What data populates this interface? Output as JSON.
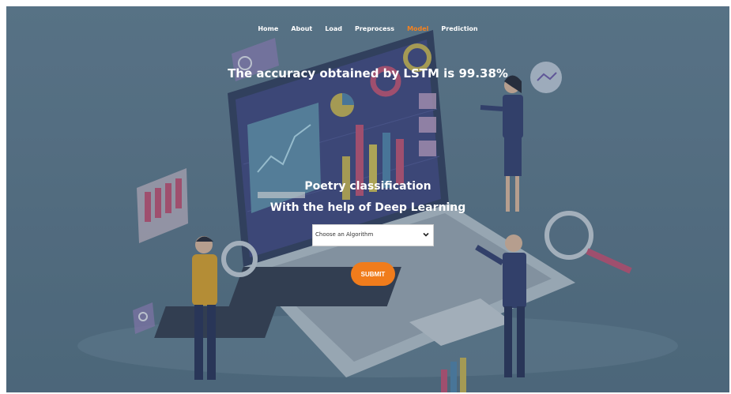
{
  "nav": {
    "items": [
      {
        "label": "Home"
      },
      {
        "label": "About"
      },
      {
        "label": "Load"
      },
      {
        "label": "Preprocess"
      },
      {
        "label": "Model"
      },
      {
        "label": "Prediction"
      }
    ],
    "active": "Model"
  },
  "accuracy_text": "The accuracy obtained by LSTM is 99.38%",
  "heading_line1": "Poetry classification",
  "heading_line2": "With the help of Deep Learning",
  "form": {
    "select_value": "Choose an Algorithm",
    "submit_label": "SUBMIT"
  },
  "colors": {
    "accent": "#f07c1c",
    "active_nav": "#f5821f",
    "background": "#577185"
  },
  "icons": [
    "chevron-down-icon",
    "search-icon",
    "magnifier-icon"
  ]
}
